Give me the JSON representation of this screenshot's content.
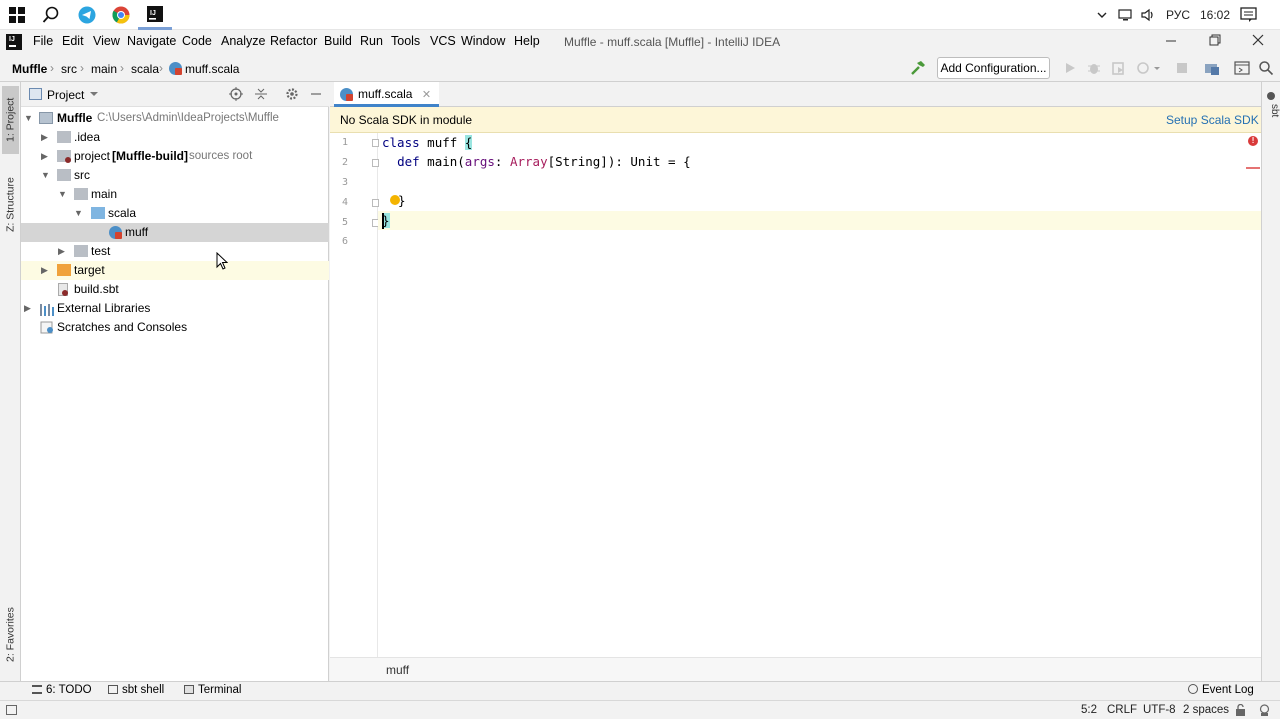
{
  "taskbar": {
    "apps": [
      "start-icon",
      "search-icon",
      "telegram-icon",
      "chrome-icon",
      "intellij-icon"
    ],
    "language": "РУС",
    "time": "16:02"
  },
  "menu": {
    "items": [
      "File",
      "Edit",
      "View",
      "Navigate",
      "Code",
      "Analyze",
      "Refactor",
      "Build",
      "Run",
      "Tools",
      "VCS",
      "Window",
      "Help"
    ],
    "title": "Muffle - muff.scala [Muffle] - IntelliJ IDEA"
  },
  "navbar": {
    "crumbs": [
      "Muffle",
      "src",
      "main",
      "scala",
      "muff.scala"
    ],
    "add_configuration": "Add Configuration..."
  },
  "left_stripe": {
    "project_tab": "1: Project",
    "structure_tab": "Z: Structure",
    "favorites_tab": "2: Favorites"
  },
  "right_stripe": {
    "sbt_tab": "sbt"
  },
  "project_panel": {
    "title": "Project",
    "tree": {
      "root_name": "Muffle",
      "root_path": "C:\\Users\\Admin\\IdeaProjects\\Muffle",
      "idea": ".idea",
      "project_prefix": "project",
      "project_bold": "[Muffle-build]",
      "project_hint": "sources root",
      "src": "src",
      "main": "main",
      "scala": "scala",
      "muff": "muff",
      "test": "test",
      "target": "target",
      "build_sbt": "build.sbt",
      "external_libraries": "External Libraries",
      "scratches": "Scratches and Consoles"
    }
  },
  "editor": {
    "tab_label": "muff.scala",
    "banner_text": "No Scala SDK in module",
    "banner_action": "Setup Scala SDK",
    "line_numbers": [
      "1",
      "2",
      "3",
      "4",
      "5",
      "6"
    ],
    "code": {
      "l1_kw": "class",
      "l1_name": " muff ",
      "l1_brace": "{",
      "l2_indent": "  ",
      "l2_kw": "def",
      "l2_name": " main(",
      "l2_param": "args",
      "l2_colon": ": ",
      "l2_array": "Array",
      "l2_rest": "[String]): Unit = {",
      "l4_brace": "}",
      "l5_brace": "}"
    },
    "bottom_breadcrumb": "muff"
  },
  "bottom_tools": {
    "todo": "6: TODO",
    "sbt_shell": "sbt shell",
    "terminal": "Terminal",
    "event_log": "Event Log"
  },
  "status": {
    "position": "5:2",
    "line_sep": "CRLF",
    "encoding": "UTF-8",
    "indent": "2 spaces"
  },
  "colors": {
    "accent": "#4083c9",
    "banner": "#fdf6d8",
    "selection": "#d5d5d5"
  }
}
